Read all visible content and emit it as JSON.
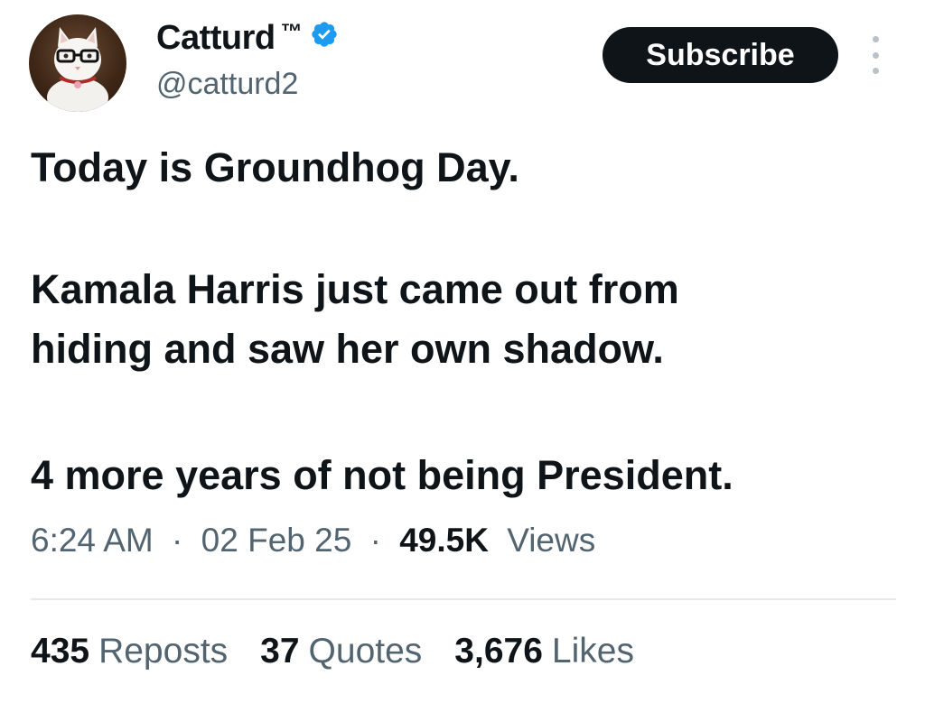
{
  "author": {
    "display_name": "Catturd",
    "trademark": "™",
    "handle": "@catturd2",
    "verified": true
  },
  "actions": {
    "subscribe_label": "Subscribe"
  },
  "tweet": {
    "lines": [
      "Today is Groundhog Day.",
      "Kamala Harris just came out from",
      "hiding and saw her own shadow.",
      "4 more years of not being President."
    ]
  },
  "meta": {
    "time": "6:24 AM",
    "separator": "·",
    "date": "02 Feb 25",
    "views_count": "49.5K",
    "views_label": "Views"
  },
  "stats": {
    "reposts_count": "435",
    "reposts_label": "Reposts",
    "quotes_count": "37",
    "quotes_label": "Quotes",
    "likes_count": "3,676",
    "likes_label": "Likes"
  },
  "colors": {
    "text_primary": "#0f1419",
    "text_secondary": "#536471",
    "verified_blue": "#1d9bf0",
    "button_bg": "#0f1419",
    "divider": "#e6e9eb"
  },
  "icons": {
    "verified": "verified-badge-icon",
    "more": "more-options-icon"
  }
}
